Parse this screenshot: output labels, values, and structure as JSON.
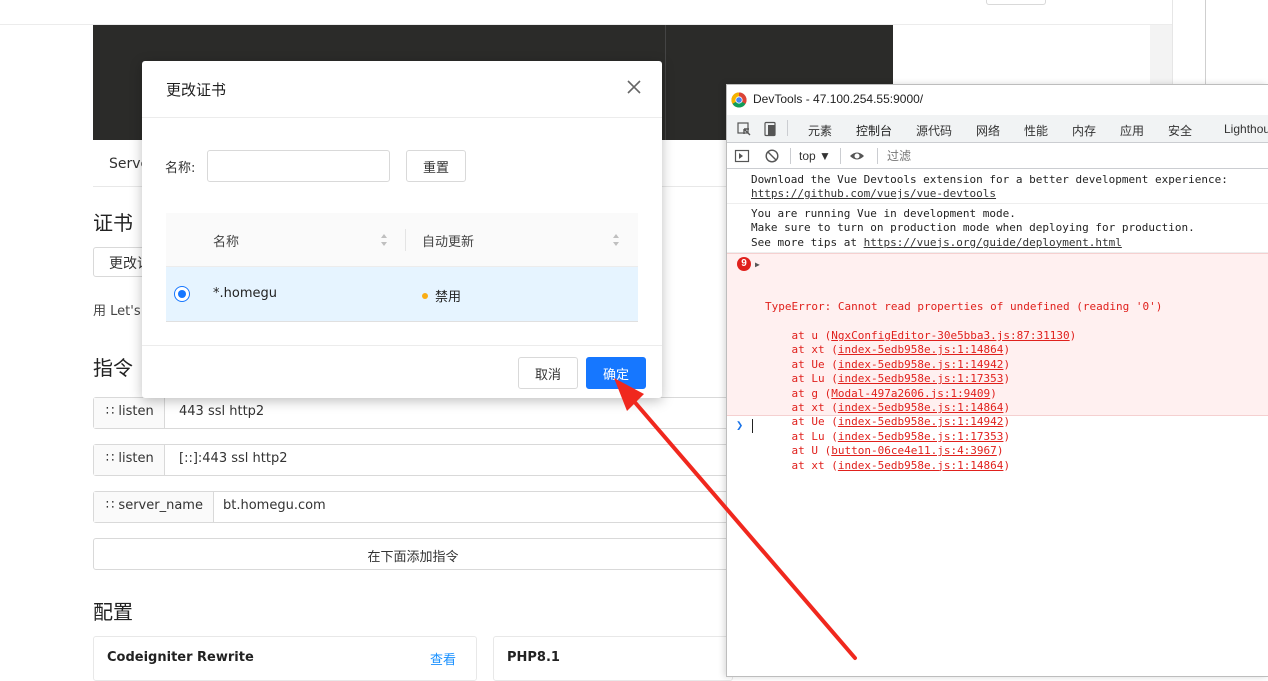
{
  "page": {
    "server_tab": "Server",
    "cert_section_title": "证书",
    "change_button": "更改证书",
    "letsencrypt_text": "用 Let's",
    "directives_title": "指令",
    "directives": [
      {
        "key": "listen",
        "value": "443 ssl http2"
      },
      {
        "key": "listen",
        "value": "[::]:443 ssl http2"
      },
      {
        "key": "server_name",
        "value": "bt.homegu.com"
      }
    ],
    "add_directive": "在下面添加指令",
    "config_title": "配置",
    "config_cards": [
      {
        "title": "Codeigniter Rewrite",
        "link": "查看"
      },
      {
        "title": "PHP8.1"
      }
    ]
  },
  "modal": {
    "title": "更改证书",
    "name_label": "名称:",
    "name_value": "",
    "reset_label": "重置",
    "columns": [
      "名称",
      "自动更新"
    ],
    "rows": [
      {
        "name": "*.homegu",
        "auto_update": "禁用",
        "selected": true
      }
    ],
    "cancel_label": "取消",
    "ok_label": "确定",
    "status_color": "#faad14",
    "primary_color": "#1677ff"
  },
  "devtools": {
    "title": "DevTools - 47.100.254.55:9000/",
    "tabs": [
      "元素",
      "控制台",
      "源代码",
      "网络",
      "性能",
      "内存",
      "应用",
      "安全",
      "Lighthouse"
    ],
    "active_tab": "控制台",
    "context": "top",
    "filter_placeholder": "过滤",
    "messages": {
      "devtools_ext": "Download the Vue Devtools extension for a better development experience:",
      "devtools_link": "https://github.com/vuejs/vue-devtools",
      "vue_dev1": "You are running Vue in development mode.",
      "vue_dev2": "Make sure to turn on production mode when deploying for production.",
      "vue_dev3_prefix": "See more tips at ",
      "vue_dev3_link": "https://vuejs.org/guide/deployment.html"
    },
    "error": {
      "count": "9",
      "message": "TypeError: Cannot read properties of undefined (reading '0')",
      "trace": [
        {
          "fn": "u",
          "loc": "NgxConfigEditor-30e5bba3.js:87:31130"
        },
        {
          "fn": "xt",
          "loc": "index-5edb958e.js:1:14864"
        },
        {
          "fn": "Ue",
          "loc": "index-5edb958e.js:1:14942"
        },
        {
          "fn": "Lu",
          "loc": "index-5edb958e.js:1:17353"
        },
        {
          "fn": "g",
          "loc": "Modal-497a2606.js:1:9409"
        },
        {
          "fn": "xt",
          "loc": "index-5edb958e.js:1:14864"
        },
        {
          "fn": "Ue",
          "loc": "index-5edb958e.js:1:14942"
        },
        {
          "fn": "Lu",
          "loc": "index-5edb958e.js:1:17353"
        },
        {
          "fn": "U",
          "loc": "button-06ce4e11.js:4:3967"
        },
        {
          "fn": "xt",
          "loc": "index-5edb958e.js:1:14864"
        }
      ],
      "color": "#e0211d"
    }
  },
  "annotation_color": "#f0281e"
}
